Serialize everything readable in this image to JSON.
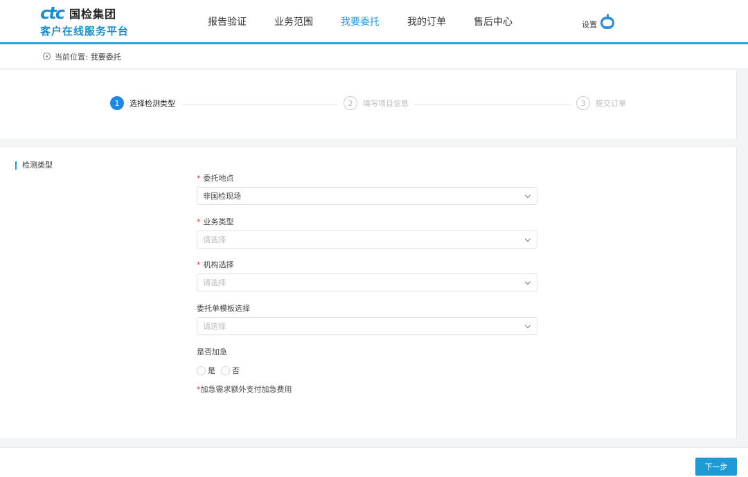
{
  "header": {
    "logo_mark": "ctc",
    "logo_name": "国检集团",
    "logo_subtitle": "客户在线服务平台",
    "nav": [
      {
        "label": "报告验证",
        "active": false
      },
      {
        "label": "业务范围",
        "active": false
      },
      {
        "label": "我要委托",
        "active": true
      },
      {
        "label": "我的订单",
        "active": false
      },
      {
        "label": "售后中心",
        "active": false
      }
    ],
    "settings_label": "设置"
  },
  "breadcrumb": {
    "label": "当前位置:",
    "current": "我要委托"
  },
  "steps": [
    {
      "num": "1",
      "label": "选择检测类型",
      "active": true
    },
    {
      "num": "2",
      "label": "填写项目信息",
      "active": false
    },
    {
      "num": "3",
      "label": "提交订单",
      "active": false
    }
  ],
  "form": {
    "section_title": "检测类型",
    "fields": [
      {
        "label": "委托地点",
        "required": true,
        "value": "非国检现场",
        "placeholder": ""
      },
      {
        "label": "业务类型",
        "required": true,
        "value": "",
        "placeholder": "请选择"
      },
      {
        "label": "机构选择",
        "required": true,
        "value": "",
        "placeholder": "请选择"
      },
      {
        "label": "委托单模板选择",
        "required": false,
        "value": "",
        "placeholder": "请选择"
      }
    ],
    "urgent_label": "是否加急",
    "urgent_options": [
      "是",
      "否"
    ],
    "note_star": "*",
    "note": "加急需求额外支付加急费用"
  },
  "footer": {
    "next_label": "下一步"
  },
  "colors": {
    "accent": "#1e9bd7",
    "step_active": "#1e88e5",
    "required": "#e33333"
  }
}
